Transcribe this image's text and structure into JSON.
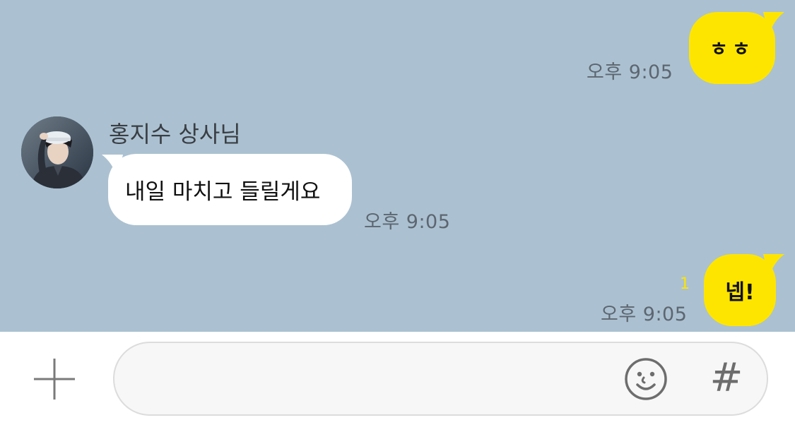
{
  "colors": {
    "chat_background": "#abc1d1",
    "my_bubble": "#fee500",
    "their_bubble": "#ffffff",
    "timestamp": "#5d6670",
    "unread_count": "#fee500"
  },
  "messages": [
    {
      "side": "mine",
      "text": "ㅎㅎ",
      "time": "오후 9:05"
    },
    {
      "side": "theirs",
      "sender": "홍지수 상사님",
      "text": "내일 마치고 들릴게요",
      "time": "오후 9:05",
      "avatar_icon": "profile-photo"
    },
    {
      "side": "mine",
      "text": "넵!",
      "time": "오후 9:05",
      "unread": "1"
    }
  ],
  "input_bar": {
    "plus_icon": "plus-icon",
    "message_value": "",
    "emoji_icon": "smiley-icon",
    "hash_label": "#"
  }
}
